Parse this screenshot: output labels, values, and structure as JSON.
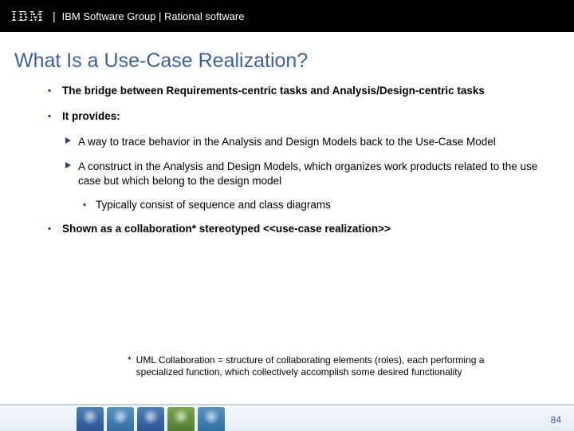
{
  "header": {
    "logo_text": "IBM",
    "separator": "|",
    "group_text": "IBM Software Group | Rational software"
  },
  "title": "What Is a Use-Case Realization?",
  "bullets": {
    "b1": "The bridge between Requirements-centric tasks and Analysis/Design-centric tasks",
    "b2": "It provides:",
    "b2_sub1": "A way to trace behavior in the Analysis and Design Models back to the Use-Case Model",
    "b2_sub2": "A construct in the Analysis and Design Models, which organizes work products related to the use case but which belong to the design model",
    "b2_sub2_sub1": "Typically consist of sequence and class diagrams",
    "b3": "Shown as a collaboration* stereotyped <<use-case realization>>"
  },
  "footnote": {
    "star": "*",
    "text": "UML Collaboration = structure of collaborating elements (roles), each performing a specialized function, which collectively accomplish some desired functionality"
  },
  "page_number": "84"
}
